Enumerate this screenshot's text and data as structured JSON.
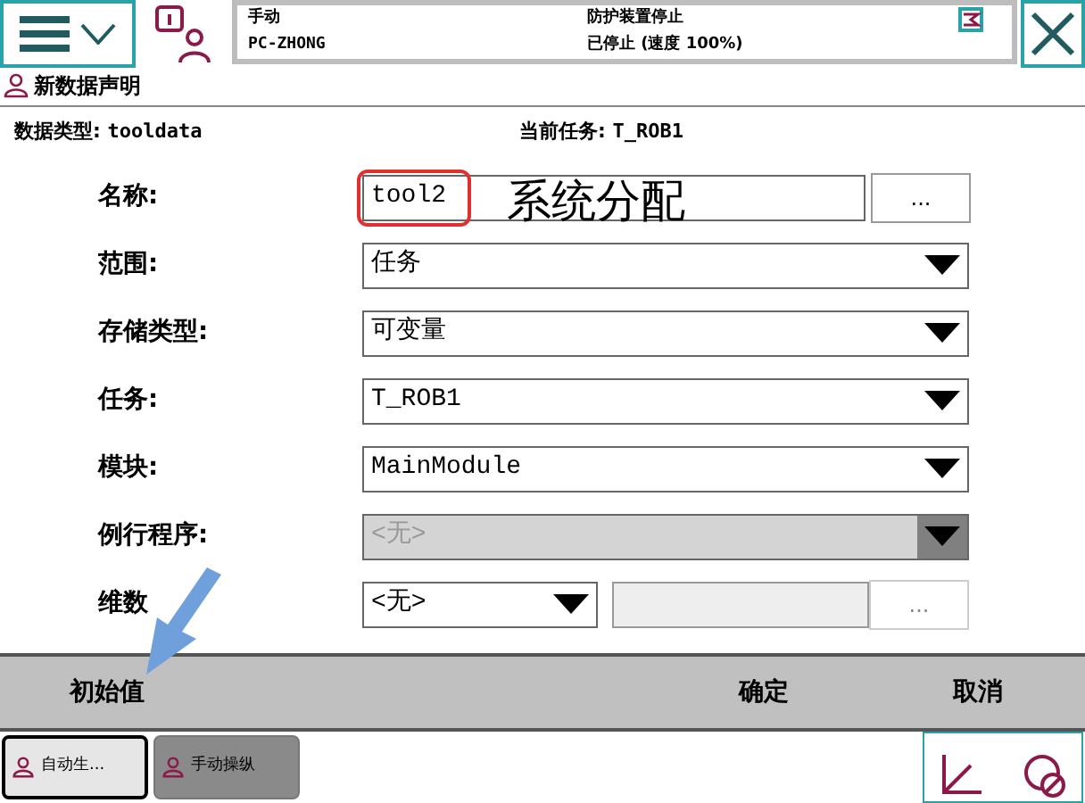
{
  "status": {
    "mode": "手动",
    "controller": "PC-ZHONG",
    "safety": "防护装置停止",
    "run_state": "已停止 (速度 100%)"
  },
  "view_title": "新数据声明",
  "data_type": {
    "label": "数据类型:",
    "value": "tooldata"
  },
  "current_task": {
    "label": "当前任务:",
    "value": "T_ROB1"
  },
  "fields": [
    {
      "kind": "text",
      "label": "名称:",
      "value": "tool2",
      "button": "..."
    },
    {
      "kind": "dropdown",
      "label": "范围:",
      "value": "任务",
      "disabled": false
    },
    {
      "kind": "dropdown",
      "label": "存储类型:",
      "value": "可变量",
      "disabled": false
    },
    {
      "kind": "dropdown",
      "label": "任务:",
      "value": "T_ROB1",
      "disabled": false
    },
    {
      "kind": "dropdown",
      "label": "模块:",
      "value": "MainModule",
      "disabled": false
    },
    {
      "kind": "dropdown",
      "label": "例行程序:",
      "value": "<无>",
      "disabled": true
    },
    {
      "kind": "dims",
      "label": "维数",
      "value": "<无>",
      "button": "..."
    }
  ],
  "annotation": {
    "text": "系统分配"
  },
  "footer_buttons": [
    "初始值",
    "确定",
    "取消"
  ],
  "taskbar": [
    {
      "label": "自动生...",
      "selected": true
    },
    {
      "label": "手动操纵",
      "selected": false
    }
  ]
}
